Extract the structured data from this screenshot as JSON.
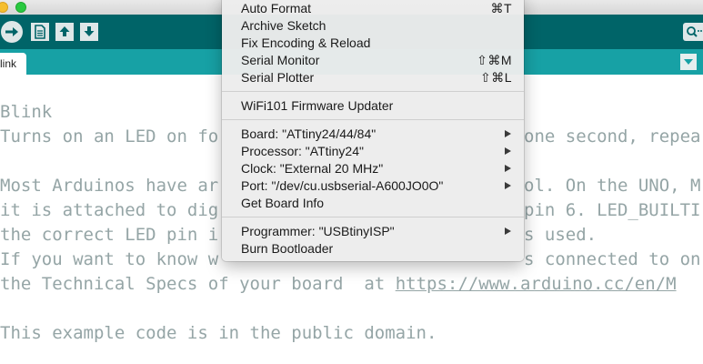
{
  "toolbar": {
    "buttons": [
      "verify-upload",
      "new",
      "open",
      "save"
    ],
    "icons": {
      "upload": "right-arrow-icon",
      "new": "document-icon",
      "open": "up-arrow-icon",
      "save": "down-arrow-icon",
      "serial": "magnifier-icon"
    }
  },
  "tabs": [
    {
      "label": "link"
    }
  ],
  "editor": {
    "lines": [
      "Blink",
      "Turns on an LED on fo",
      "",
      "Most Arduinos have ar",
      "it is attached to dig",
      "the correct LED pin i",
      "If you want to know w",
      "the Technical Specs of your board  at ",
      "",
      "This example code is in the public domain."
    ],
    "right_fragments": [
      {
        "line": 1,
        "text": "one second, repea"
      },
      {
        "line": 3,
        "text": "ol. On the UNO, M"
      },
      {
        "line": 4,
        "text": "pin 6. LED_BUILTI"
      },
      {
        "line": 5,
        "text": "s used."
      },
      {
        "line": 6,
        "text": "s connected to on"
      }
    ],
    "link_text": "https://www.arduino.cc/en/M"
  },
  "menu": {
    "items": [
      {
        "label": "Auto Format",
        "shortcut": "⌘T",
        "submenu": false
      },
      {
        "label": "Archive Sketch",
        "shortcut": "",
        "submenu": false
      },
      {
        "label": "Fix Encoding & Reload",
        "shortcut": "",
        "submenu": false
      },
      {
        "label": "Serial Monitor",
        "shortcut": "⇧⌘M",
        "submenu": false
      },
      {
        "label": "Serial Plotter",
        "shortcut": "⇧⌘L",
        "submenu": false
      },
      {
        "label": "WiFi101 Firmware Updater",
        "shortcut": "",
        "submenu": false
      },
      {
        "label": "Board: \"ATtiny24/44/84\"",
        "shortcut": "",
        "submenu": true
      },
      {
        "label": "Processor: \"ATtiny24\"",
        "shortcut": "",
        "submenu": true
      },
      {
        "label": "Clock: \"External 20 MHz\"",
        "shortcut": "",
        "submenu": true
      },
      {
        "label": "Port: \"/dev/cu.usbserial-A600JO0O\"",
        "shortcut": "",
        "submenu": true
      },
      {
        "label": "Get Board Info",
        "shortcut": "",
        "submenu": false
      },
      {
        "label": "Programmer: \"USBtinyISP\"",
        "shortcut": "",
        "submenu": true
      },
      {
        "label": "Burn Bootloader",
        "shortcut": "",
        "submenu": false
      }
    ]
  },
  "colors": {
    "toolbar": "#006468",
    "tabstrip": "#17a1a5",
    "code_comment": "#95a5a6",
    "menu_bg": "#ececec"
  }
}
